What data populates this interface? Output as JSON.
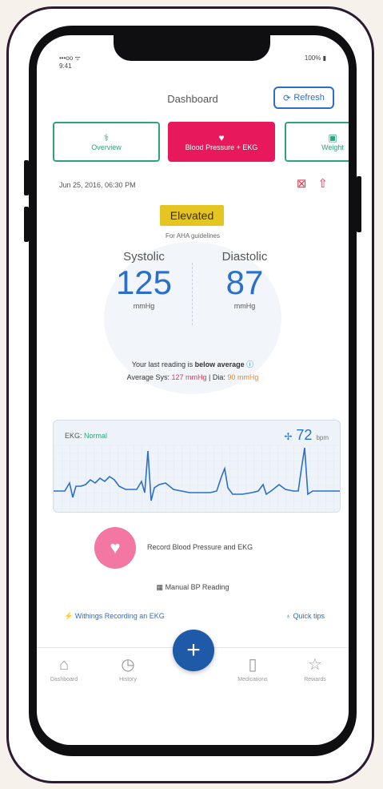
{
  "status_bar": {
    "carrier": "•••oo ᯤ",
    "time": "9:41",
    "battery": "100%"
  },
  "header": {
    "title": "Dashboard",
    "refresh_label": "Refresh"
  },
  "tabs": [
    {
      "label": "Overview",
      "icon": "stethoscope-icon"
    },
    {
      "label": "Blood Pressure + EKG",
      "icon": "heart-icon"
    },
    {
      "label": "Weight",
      "icon": "scale-icon"
    }
  ],
  "reading": {
    "date": "Jun 25, 2016, 06:30 PM",
    "classification": "Elevated",
    "for_text": "For AHA guidelines",
    "systolic_label": "Systolic",
    "systolic_value": "125",
    "systolic_unit": "mmHg",
    "diastolic_label": "Diastolic",
    "diastolic_value": "87",
    "diastolic_unit": "mmHg",
    "comparison_prefix": "Your last reading is ",
    "comparison_emphasis": "below average",
    "average_label": "Average Sys: ",
    "average_sys": "127 mmHg",
    "separator": " | ",
    "average_dia_label": "Dia: ",
    "average_dia": "90 mmHg"
  },
  "ekg": {
    "label": "EKG: ",
    "status": "Normal",
    "heart_rate": "72",
    "unit": "bpm"
  },
  "actions": {
    "record_label": "Record Blood Pressure and EKG",
    "manual_label": "Manual BP Reading",
    "link_left": "Withings Recording an EKG",
    "link_right": "Quick tips"
  },
  "nav": [
    {
      "label": "Dashboard",
      "icon": "home-icon"
    },
    {
      "label": "History",
      "icon": "clock-icon"
    },
    {
      "label": "Medications",
      "icon": "pill-bottle-icon"
    },
    {
      "label": "Rewards",
      "icon": "star-icon"
    }
  ],
  "colors": {
    "accent_blue": "#2a6fc9",
    "tab_pink": "#e8185c",
    "tab_green": "#2fa37a",
    "badge_yellow": "#e4c521",
    "alert_red": "#e0384a"
  }
}
